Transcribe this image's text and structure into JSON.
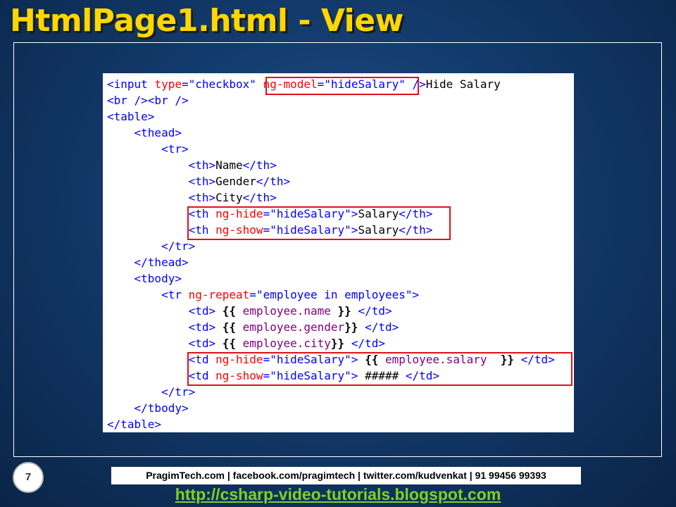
{
  "slide": {
    "title": "HtmlPage1.html - View",
    "page_number": "7",
    "footer_info": "PragimTech.com | facebook.com/pragimtech | twitter.com/kudvenkat | 91 99456 99393",
    "footer_link": "http://csharp-video-tutorials.blogspot.com"
  },
  "code": {
    "lines": [
      [
        [
          "tag",
          "<input "
        ],
        [
          "attr",
          "type"
        ],
        [
          "tag",
          "="
        ],
        [
          "str",
          "\"checkbox\""
        ],
        [
          "text",
          " "
        ],
        [
          "attr",
          "ng-model"
        ],
        [
          "tag",
          "="
        ],
        [
          "str",
          "\"hideSalary\""
        ],
        [
          "text",
          " "
        ],
        [
          "tag",
          "/>"
        ],
        [
          "text",
          "Hide Salary"
        ]
      ],
      [
        [
          "tag",
          "<br /><br />"
        ]
      ],
      [
        [
          "tag",
          "<table>"
        ]
      ],
      [
        [
          "text",
          "    "
        ],
        [
          "tag",
          "<thead>"
        ]
      ],
      [
        [
          "text",
          "        "
        ],
        [
          "tag",
          "<tr>"
        ]
      ],
      [
        [
          "text",
          "            "
        ],
        [
          "tag",
          "<th>"
        ],
        [
          "text",
          "Name"
        ],
        [
          "tag",
          "</th>"
        ]
      ],
      [
        [
          "text",
          "            "
        ],
        [
          "tag",
          "<th>"
        ],
        [
          "text",
          "Gender"
        ],
        [
          "tag",
          "</th>"
        ]
      ],
      [
        [
          "text",
          "            "
        ],
        [
          "tag",
          "<th>"
        ],
        [
          "text",
          "City"
        ],
        [
          "tag",
          "</th>"
        ]
      ],
      [
        [
          "text",
          "            "
        ],
        [
          "tag",
          "<th "
        ],
        [
          "attr",
          "ng-hide"
        ],
        [
          "tag",
          "="
        ],
        [
          "str",
          "\"hideSalary\""
        ],
        [
          "tag",
          ">"
        ],
        [
          "text",
          "Salary"
        ],
        [
          "tag",
          "</th>"
        ]
      ],
      [
        [
          "text",
          "            "
        ],
        [
          "tag",
          "<th "
        ],
        [
          "attr",
          "ng-show"
        ],
        [
          "tag",
          "="
        ],
        [
          "str",
          "\"hideSalary\""
        ],
        [
          "tag",
          ">"
        ],
        [
          "text",
          "Salary"
        ],
        [
          "tag",
          "</th>"
        ]
      ],
      [
        [
          "text",
          "        "
        ],
        [
          "tag",
          "</tr>"
        ]
      ],
      [
        [
          "text",
          "    "
        ],
        [
          "tag",
          "</thead>"
        ]
      ],
      [
        [
          "text",
          "    "
        ],
        [
          "tag",
          "<tbody>"
        ]
      ],
      [
        [
          "text",
          "        "
        ],
        [
          "tag",
          "<tr "
        ],
        [
          "attr",
          "ng-repeat"
        ],
        [
          "tag",
          "="
        ],
        [
          "str",
          "\"employee in employees\""
        ],
        [
          "tag",
          ">"
        ]
      ],
      [
        [
          "text",
          "            "
        ],
        [
          "tag",
          "<td>"
        ],
        [
          "text",
          " "
        ],
        [
          "brace",
          "{{"
        ],
        [
          "text",
          " "
        ],
        [
          "expr",
          "employee.name"
        ],
        [
          "text",
          " "
        ],
        [
          "brace",
          "}}"
        ],
        [
          "text",
          " "
        ],
        [
          "tag",
          "</td>"
        ]
      ],
      [
        [
          "text",
          "            "
        ],
        [
          "tag",
          "<td>"
        ],
        [
          "text",
          " "
        ],
        [
          "brace",
          "{{"
        ],
        [
          "text",
          " "
        ],
        [
          "expr",
          "employee.gender"
        ],
        [
          "brace",
          "}}"
        ],
        [
          "text",
          " "
        ],
        [
          "tag",
          "</td>"
        ]
      ],
      [
        [
          "text",
          "            "
        ],
        [
          "tag",
          "<td>"
        ],
        [
          "text",
          " "
        ],
        [
          "brace",
          "{{"
        ],
        [
          "text",
          " "
        ],
        [
          "expr",
          "employee.city"
        ],
        [
          "brace",
          "}}"
        ],
        [
          "text",
          " "
        ],
        [
          "tag",
          "</td>"
        ]
      ],
      [
        [
          "text",
          "            "
        ],
        [
          "tag",
          "<td "
        ],
        [
          "attr",
          "ng-hide"
        ],
        [
          "tag",
          "="
        ],
        [
          "str",
          "\"hideSalary\""
        ],
        [
          "tag",
          ">"
        ],
        [
          "text",
          " "
        ],
        [
          "brace",
          "{{"
        ],
        [
          "text",
          " "
        ],
        [
          "expr",
          "employee.salary"
        ],
        [
          "text",
          "  "
        ],
        [
          "brace",
          "}}"
        ],
        [
          "text",
          " "
        ],
        [
          "tag",
          "</td>"
        ]
      ],
      [
        [
          "text",
          "            "
        ],
        [
          "tag",
          "<td "
        ],
        [
          "attr",
          "ng-show"
        ],
        [
          "tag",
          "="
        ],
        [
          "str",
          "\"hideSalary\""
        ],
        [
          "tag",
          ">"
        ],
        [
          "text",
          " ##### "
        ],
        [
          "tag",
          "</td>"
        ]
      ],
      [
        [
          "text",
          "        "
        ],
        [
          "tag",
          "</tr>"
        ]
      ],
      [
        [
          "text",
          "    "
        ],
        [
          "tag",
          "</tbody>"
        ]
      ],
      [
        [
          "tag",
          "</table>"
        ]
      ]
    ]
  },
  "colors": {
    "title": "#ffd700",
    "tag": "#0000ff",
    "attribute": "#ff0000",
    "string": "#0000ff",
    "expression": "#800080",
    "highlight_border": "#e0101a",
    "footer_link": "#7ed321"
  }
}
